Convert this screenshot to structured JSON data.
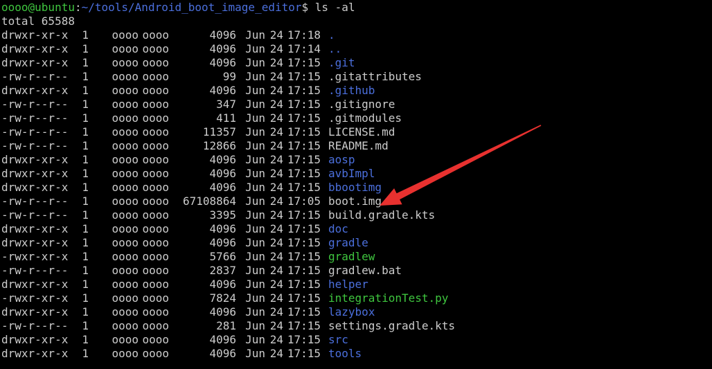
{
  "prompt": {
    "user_host": "oooo@ubuntu",
    "colon": ":",
    "path": "~/tools/Android_boot_image_editor",
    "dollar": "$",
    "command": " ls -al"
  },
  "total_line": "total 65588",
  "entries": [
    {
      "perm": "drwxr-xr-x",
      "links": "1",
      "owner": "oooo",
      "group": "oooo",
      "size": "4096",
      "month": "Jun",
      "day": "24",
      "time": "17:18",
      "name": ".",
      "type": "dir"
    },
    {
      "perm": "drwxr-xr-x",
      "links": "1",
      "owner": "oooo",
      "group": "oooo",
      "size": "4096",
      "month": "Jun",
      "day": "24",
      "time": "17:14",
      "name": "..",
      "type": "dir"
    },
    {
      "perm": "drwxr-xr-x",
      "links": "1",
      "owner": "oooo",
      "group": "oooo",
      "size": "4096",
      "month": "Jun",
      "day": "24",
      "time": "17:15",
      "name": ".git",
      "type": "dir"
    },
    {
      "perm": "-rw-r--r--",
      "links": "1",
      "owner": "oooo",
      "group": "oooo",
      "size": "99",
      "month": "Jun",
      "day": "24",
      "time": "17:15",
      "name": ".gitattributes",
      "type": "file"
    },
    {
      "perm": "drwxr-xr-x",
      "links": "1",
      "owner": "oooo",
      "group": "oooo",
      "size": "4096",
      "month": "Jun",
      "day": "24",
      "time": "17:15",
      "name": ".github",
      "type": "dir"
    },
    {
      "perm": "-rw-r--r--",
      "links": "1",
      "owner": "oooo",
      "group": "oooo",
      "size": "347",
      "month": "Jun",
      "day": "24",
      "time": "17:15",
      "name": ".gitignore",
      "type": "file"
    },
    {
      "perm": "-rw-r--r--",
      "links": "1",
      "owner": "oooo",
      "group": "oooo",
      "size": "411",
      "month": "Jun",
      "day": "24",
      "time": "17:15",
      "name": ".gitmodules",
      "type": "file"
    },
    {
      "perm": "-rw-r--r--",
      "links": "1",
      "owner": "oooo",
      "group": "oooo",
      "size": "11357",
      "month": "Jun",
      "day": "24",
      "time": "17:15",
      "name": "LICENSE.md",
      "type": "file"
    },
    {
      "perm": "-rw-r--r--",
      "links": "1",
      "owner": "oooo",
      "group": "oooo",
      "size": "12866",
      "month": "Jun",
      "day": "24",
      "time": "17:15",
      "name": "README.md",
      "type": "file"
    },
    {
      "perm": "drwxr-xr-x",
      "links": "1",
      "owner": "oooo",
      "group": "oooo",
      "size": "4096",
      "month": "Jun",
      "day": "24",
      "time": "17:15",
      "name": "aosp",
      "type": "dir"
    },
    {
      "perm": "drwxr-xr-x",
      "links": "1",
      "owner": "oooo",
      "group": "oooo",
      "size": "4096",
      "month": "Jun",
      "day": "24",
      "time": "17:15",
      "name": "avbImpl",
      "type": "dir"
    },
    {
      "perm": "drwxr-xr-x",
      "links": "1",
      "owner": "oooo",
      "group": "oooo",
      "size": "4096",
      "month": "Jun",
      "day": "24",
      "time": "17:15",
      "name": "bbootimg",
      "type": "dir"
    },
    {
      "perm": "-rw-r--r--",
      "links": "1",
      "owner": "oooo",
      "group": "oooo",
      "size": "67108864",
      "month": "Jun",
      "day": "24",
      "time": "17:05",
      "name": "boot.img",
      "type": "file"
    },
    {
      "perm": "-rw-r--r--",
      "links": "1",
      "owner": "oooo",
      "group": "oooo",
      "size": "3395",
      "month": "Jun",
      "day": "24",
      "time": "17:15",
      "name": "build.gradle.kts",
      "type": "file"
    },
    {
      "perm": "drwxr-xr-x",
      "links": "1",
      "owner": "oooo",
      "group": "oooo",
      "size": "4096",
      "month": "Jun",
      "day": "24",
      "time": "17:15",
      "name": "doc",
      "type": "dir"
    },
    {
      "perm": "drwxr-xr-x",
      "links": "1",
      "owner": "oooo",
      "group": "oooo",
      "size": "4096",
      "month": "Jun",
      "day": "24",
      "time": "17:15",
      "name": "gradle",
      "type": "dir"
    },
    {
      "perm": "-rwxr-xr-x",
      "links": "1",
      "owner": "oooo",
      "group": "oooo",
      "size": "5766",
      "month": "Jun",
      "day": "24",
      "time": "17:15",
      "name": "gradlew",
      "type": "exec"
    },
    {
      "perm": "-rw-r--r--",
      "links": "1",
      "owner": "oooo",
      "group": "oooo",
      "size": "2837",
      "month": "Jun",
      "day": "24",
      "time": "17:15",
      "name": "gradlew.bat",
      "type": "file"
    },
    {
      "perm": "drwxr-xr-x",
      "links": "1",
      "owner": "oooo",
      "group": "oooo",
      "size": "4096",
      "month": "Jun",
      "day": "24",
      "time": "17:15",
      "name": "helper",
      "type": "dir"
    },
    {
      "perm": "-rwxr-xr-x",
      "links": "1",
      "owner": "oooo",
      "group": "oooo",
      "size": "7824",
      "month": "Jun",
      "day": "24",
      "time": "17:15",
      "name": "integrationTest.py",
      "type": "exec"
    },
    {
      "perm": "drwxr-xr-x",
      "links": "1",
      "owner": "oooo",
      "group": "oooo",
      "size": "4096",
      "month": "Jun",
      "day": "24",
      "time": "17:15",
      "name": "lazybox",
      "type": "dir"
    },
    {
      "perm": "-rw-r--r--",
      "links": "1",
      "owner": "oooo",
      "group": "oooo",
      "size": "281",
      "month": "Jun",
      "day": "24",
      "time": "17:15",
      "name": "settings.gradle.kts",
      "type": "file"
    },
    {
      "perm": "drwxr-xr-x",
      "links": "1",
      "owner": "oooo",
      "group": "oooo",
      "size": "4096",
      "month": "Jun",
      "day": "24",
      "time": "17:15",
      "name": "src",
      "type": "dir"
    },
    {
      "perm": "drwxr-xr-x",
      "links": "1",
      "owner": "oooo",
      "group": "oooo",
      "size": "4096",
      "month": "Jun",
      "day": "24",
      "time": "17:15",
      "name": "tools",
      "type": "dir"
    }
  ],
  "annotation": {
    "icon": "red-arrow-icon",
    "points_to": "boot.img",
    "color": "#e8312f"
  },
  "colors": {
    "background": "#000000",
    "text": "#cccccc",
    "directory": "#4b6fdc",
    "executable": "#3fc63f",
    "prompt_user": "#3fc63f"
  }
}
